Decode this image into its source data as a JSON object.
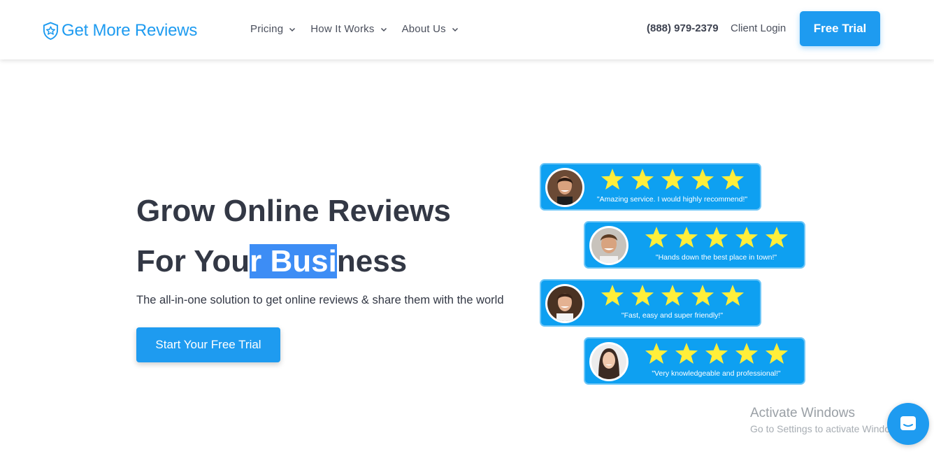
{
  "brand": {
    "name": "Get More Reviews",
    "color": "#1e9bf0",
    "icon": "shield-star-icon"
  },
  "nav": {
    "items": [
      {
        "label": "Pricing",
        "icon": "chevron-down-icon"
      },
      {
        "label": "How It Works",
        "icon": "chevron-down-icon"
      },
      {
        "label": "About Us",
        "icon": "chevron-down-icon"
      }
    ],
    "phone": "(888) 979-2379",
    "login": "Client Login",
    "trial": "Free Trial"
  },
  "hero": {
    "line1": "Grow Online Reviews",
    "line2_a": "For You",
    "line2_sel": "r Busi",
    "line2_b": "ness",
    "subtitle": "The all-in-one solution to get online reviews & share them with the world",
    "cta": "Start Your Free Trial"
  },
  "reviews": [
    {
      "quote": "\"Amazing service. I would highly recommend!\"",
      "rating": 5
    },
    {
      "quote": "\"Hands down the best place in town!\"",
      "rating": 5
    },
    {
      "quote": "\"Fast, easy and super friendly!\"",
      "rating": 5
    },
    {
      "quote": "\"Very knowledgeable and professional!\"",
      "rating": 5
    }
  ],
  "watermark": {
    "title": "Activate Windows",
    "subtitle": "Go to Settings to activate Windows."
  },
  "chat": {
    "icon": "chat-icon"
  },
  "colors": {
    "accent": "#1e9bf0",
    "card": "#0ea0f1",
    "star": "#ffee3a",
    "text": "#333845",
    "selection": "#3d8df5"
  }
}
